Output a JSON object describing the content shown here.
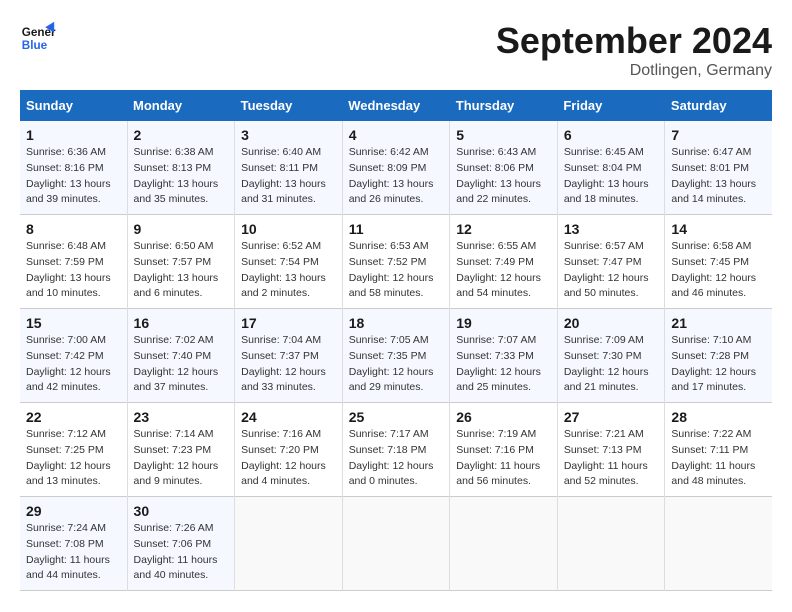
{
  "header": {
    "logo_line1": "General",
    "logo_line2": "Blue",
    "month": "September 2024",
    "location": "Dotlingen, Germany"
  },
  "days_of_week": [
    "Sunday",
    "Monday",
    "Tuesday",
    "Wednesday",
    "Thursday",
    "Friday",
    "Saturday"
  ],
  "weeks": [
    [
      {
        "num": "1",
        "info": "Sunrise: 6:36 AM\nSunset: 8:16 PM\nDaylight: 13 hours\nand 39 minutes."
      },
      {
        "num": "2",
        "info": "Sunrise: 6:38 AM\nSunset: 8:13 PM\nDaylight: 13 hours\nand 35 minutes."
      },
      {
        "num": "3",
        "info": "Sunrise: 6:40 AM\nSunset: 8:11 PM\nDaylight: 13 hours\nand 31 minutes."
      },
      {
        "num": "4",
        "info": "Sunrise: 6:42 AM\nSunset: 8:09 PM\nDaylight: 13 hours\nand 26 minutes."
      },
      {
        "num": "5",
        "info": "Sunrise: 6:43 AM\nSunset: 8:06 PM\nDaylight: 13 hours\nand 22 minutes."
      },
      {
        "num": "6",
        "info": "Sunrise: 6:45 AM\nSunset: 8:04 PM\nDaylight: 13 hours\nand 18 minutes."
      },
      {
        "num": "7",
        "info": "Sunrise: 6:47 AM\nSunset: 8:01 PM\nDaylight: 13 hours\nand 14 minutes."
      }
    ],
    [
      {
        "num": "8",
        "info": "Sunrise: 6:48 AM\nSunset: 7:59 PM\nDaylight: 13 hours\nand 10 minutes."
      },
      {
        "num": "9",
        "info": "Sunrise: 6:50 AM\nSunset: 7:57 PM\nDaylight: 13 hours\nand 6 minutes."
      },
      {
        "num": "10",
        "info": "Sunrise: 6:52 AM\nSunset: 7:54 PM\nDaylight: 13 hours\nand 2 minutes."
      },
      {
        "num": "11",
        "info": "Sunrise: 6:53 AM\nSunset: 7:52 PM\nDaylight: 12 hours\nand 58 minutes."
      },
      {
        "num": "12",
        "info": "Sunrise: 6:55 AM\nSunset: 7:49 PM\nDaylight: 12 hours\nand 54 minutes."
      },
      {
        "num": "13",
        "info": "Sunrise: 6:57 AM\nSunset: 7:47 PM\nDaylight: 12 hours\nand 50 minutes."
      },
      {
        "num": "14",
        "info": "Sunrise: 6:58 AM\nSunset: 7:45 PM\nDaylight: 12 hours\nand 46 minutes."
      }
    ],
    [
      {
        "num": "15",
        "info": "Sunrise: 7:00 AM\nSunset: 7:42 PM\nDaylight: 12 hours\nand 42 minutes."
      },
      {
        "num": "16",
        "info": "Sunrise: 7:02 AM\nSunset: 7:40 PM\nDaylight: 12 hours\nand 37 minutes."
      },
      {
        "num": "17",
        "info": "Sunrise: 7:04 AM\nSunset: 7:37 PM\nDaylight: 12 hours\nand 33 minutes."
      },
      {
        "num": "18",
        "info": "Sunrise: 7:05 AM\nSunset: 7:35 PM\nDaylight: 12 hours\nand 29 minutes."
      },
      {
        "num": "19",
        "info": "Sunrise: 7:07 AM\nSunset: 7:33 PM\nDaylight: 12 hours\nand 25 minutes."
      },
      {
        "num": "20",
        "info": "Sunrise: 7:09 AM\nSunset: 7:30 PM\nDaylight: 12 hours\nand 21 minutes."
      },
      {
        "num": "21",
        "info": "Sunrise: 7:10 AM\nSunset: 7:28 PM\nDaylight: 12 hours\nand 17 minutes."
      }
    ],
    [
      {
        "num": "22",
        "info": "Sunrise: 7:12 AM\nSunset: 7:25 PM\nDaylight: 12 hours\nand 13 minutes."
      },
      {
        "num": "23",
        "info": "Sunrise: 7:14 AM\nSunset: 7:23 PM\nDaylight: 12 hours\nand 9 minutes."
      },
      {
        "num": "24",
        "info": "Sunrise: 7:16 AM\nSunset: 7:20 PM\nDaylight: 12 hours\nand 4 minutes."
      },
      {
        "num": "25",
        "info": "Sunrise: 7:17 AM\nSunset: 7:18 PM\nDaylight: 12 hours\nand 0 minutes."
      },
      {
        "num": "26",
        "info": "Sunrise: 7:19 AM\nSunset: 7:16 PM\nDaylight: 11 hours\nand 56 minutes."
      },
      {
        "num": "27",
        "info": "Sunrise: 7:21 AM\nSunset: 7:13 PM\nDaylight: 11 hours\nand 52 minutes."
      },
      {
        "num": "28",
        "info": "Sunrise: 7:22 AM\nSunset: 7:11 PM\nDaylight: 11 hours\nand 48 minutes."
      }
    ],
    [
      {
        "num": "29",
        "info": "Sunrise: 7:24 AM\nSunset: 7:08 PM\nDaylight: 11 hours\nand 44 minutes."
      },
      {
        "num": "30",
        "info": "Sunrise: 7:26 AM\nSunset: 7:06 PM\nDaylight: 11 hours\nand 40 minutes."
      },
      {
        "num": "",
        "info": ""
      },
      {
        "num": "",
        "info": ""
      },
      {
        "num": "",
        "info": ""
      },
      {
        "num": "",
        "info": ""
      },
      {
        "num": "",
        "info": ""
      }
    ]
  ]
}
